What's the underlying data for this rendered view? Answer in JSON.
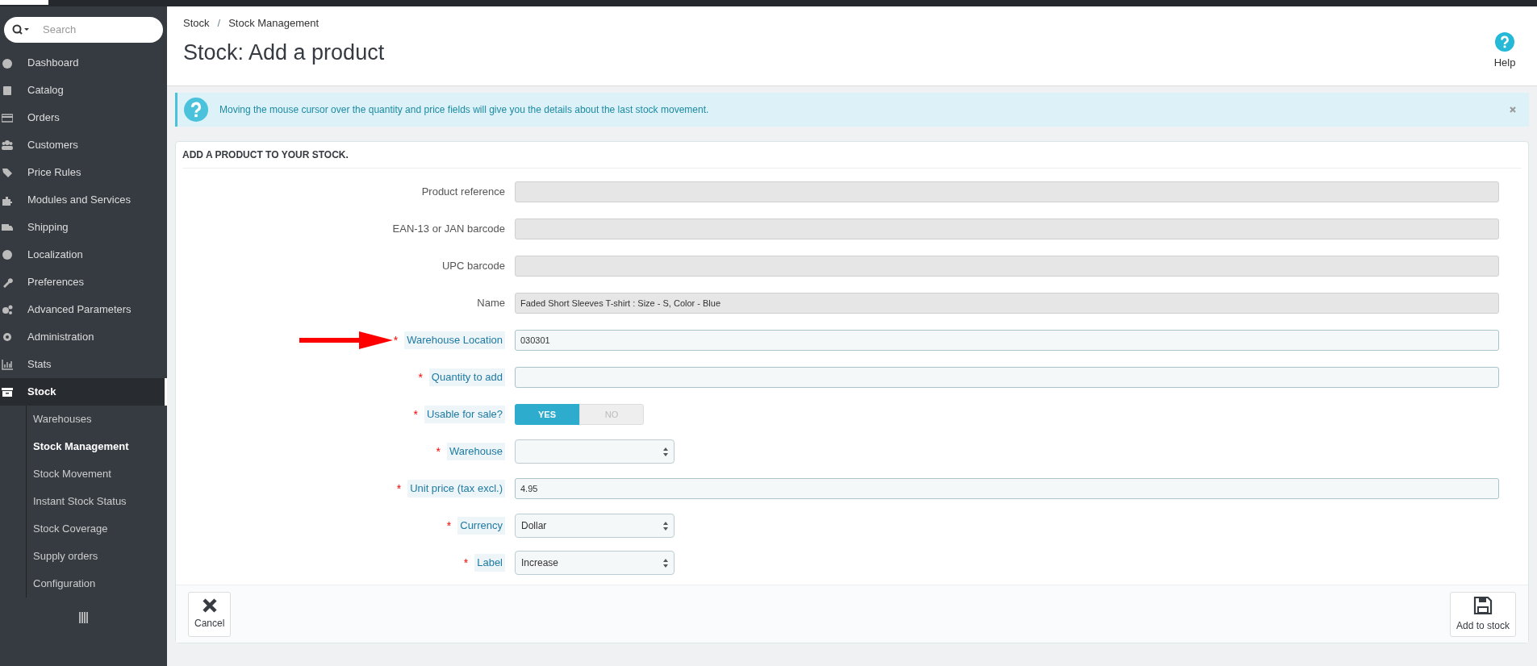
{
  "search": {
    "placeholder": "Search"
  },
  "sidebar": {
    "items": [
      {
        "label": "Dashboard",
        "selected": false
      },
      {
        "label": "Catalog",
        "selected": false
      },
      {
        "label": "Orders",
        "selected": false
      },
      {
        "label": "Customers",
        "selected": false
      },
      {
        "label": "Price Rules",
        "selected": false
      },
      {
        "label": "Modules and Services",
        "selected": false
      },
      {
        "label": "Shipping",
        "selected": false
      },
      {
        "label": "Localization",
        "selected": false
      },
      {
        "label": "Preferences",
        "selected": false
      },
      {
        "label": "Advanced Parameters",
        "selected": false
      },
      {
        "label": "Administration",
        "selected": false
      },
      {
        "label": "Stats",
        "selected": false
      },
      {
        "label": "Stock",
        "selected": true,
        "children": [
          {
            "label": "Warehouses",
            "selected": false
          },
          {
            "label": "Stock Management",
            "selected": true
          },
          {
            "label": "Stock Movement",
            "selected": false
          },
          {
            "label": "Instant Stock Status",
            "selected": false
          },
          {
            "label": "Stock Coverage",
            "selected": false
          },
          {
            "label": "Supply orders",
            "selected": false
          },
          {
            "label": "Configuration",
            "selected": false
          }
        ]
      }
    ]
  },
  "breadcrumb": [
    "Stock",
    "Stock Management"
  ],
  "breadcrumb_separator": "/",
  "page_title": "Stock: Add a product",
  "help": {
    "label": "Help"
  },
  "alert": {
    "text": "Moving the mouse cursor over the quantity and price fields will give you the details about the last stock movement."
  },
  "panel": {
    "heading": "ADD A PRODUCT TO YOUR STOCK.",
    "fields": [
      {
        "kind": "text",
        "label": "Product reference",
        "disabled": true,
        "highlighted": false
      },
      {
        "kind": "text",
        "label": "EAN-13 or JAN barcode",
        "disabled": true,
        "highlighted": false
      },
      {
        "kind": "text",
        "label": "UPC barcode",
        "disabled": true,
        "highlighted": false
      },
      {
        "kind": "text",
        "label": "Name",
        "value": "Faded Short Sleeves T-shirt : Size - S, Color - Blue",
        "disabled": true,
        "highlighted": false
      },
      {
        "kind": "text",
        "label": "Warehouse Location",
        "required_mark": "*",
        "value": "030301",
        "disabled": false,
        "highlighted": true
      },
      {
        "kind": "text",
        "label": "Quantity to add",
        "required_mark": "*",
        "disabled": false,
        "highlighted": false
      },
      {
        "kind": "toggle",
        "label": "Usable for sale?",
        "required_mark": "*",
        "options": [
          {
            "label": "YES",
            "selected": true
          },
          {
            "label": "NO",
            "selected": false
          }
        ]
      },
      {
        "kind": "select",
        "label": "Warehouse",
        "required_mark": "*"
      },
      {
        "kind": "text",
        "label": "Unit price (tax excl.)",
        "required_mark": "*",
        "value": "4.95",
        "disabled": false,
        "highlighted": false
      },
      {
        "kind": "select",
        "label": "Currency",
        "required_mark": "*",
        "value": "Dollar"
      },
      {
        "kind": "select",
        "label": "Label",
        "required_mark": "*",
        "value": "Increase"
      }
    ],
    "buttons": [
      {
        "kind": "cancel",
        "label": "Cancel"
      },
      {
        "kind": "save",
        "label": "Add to stock"
      }
    ]
  }
}
